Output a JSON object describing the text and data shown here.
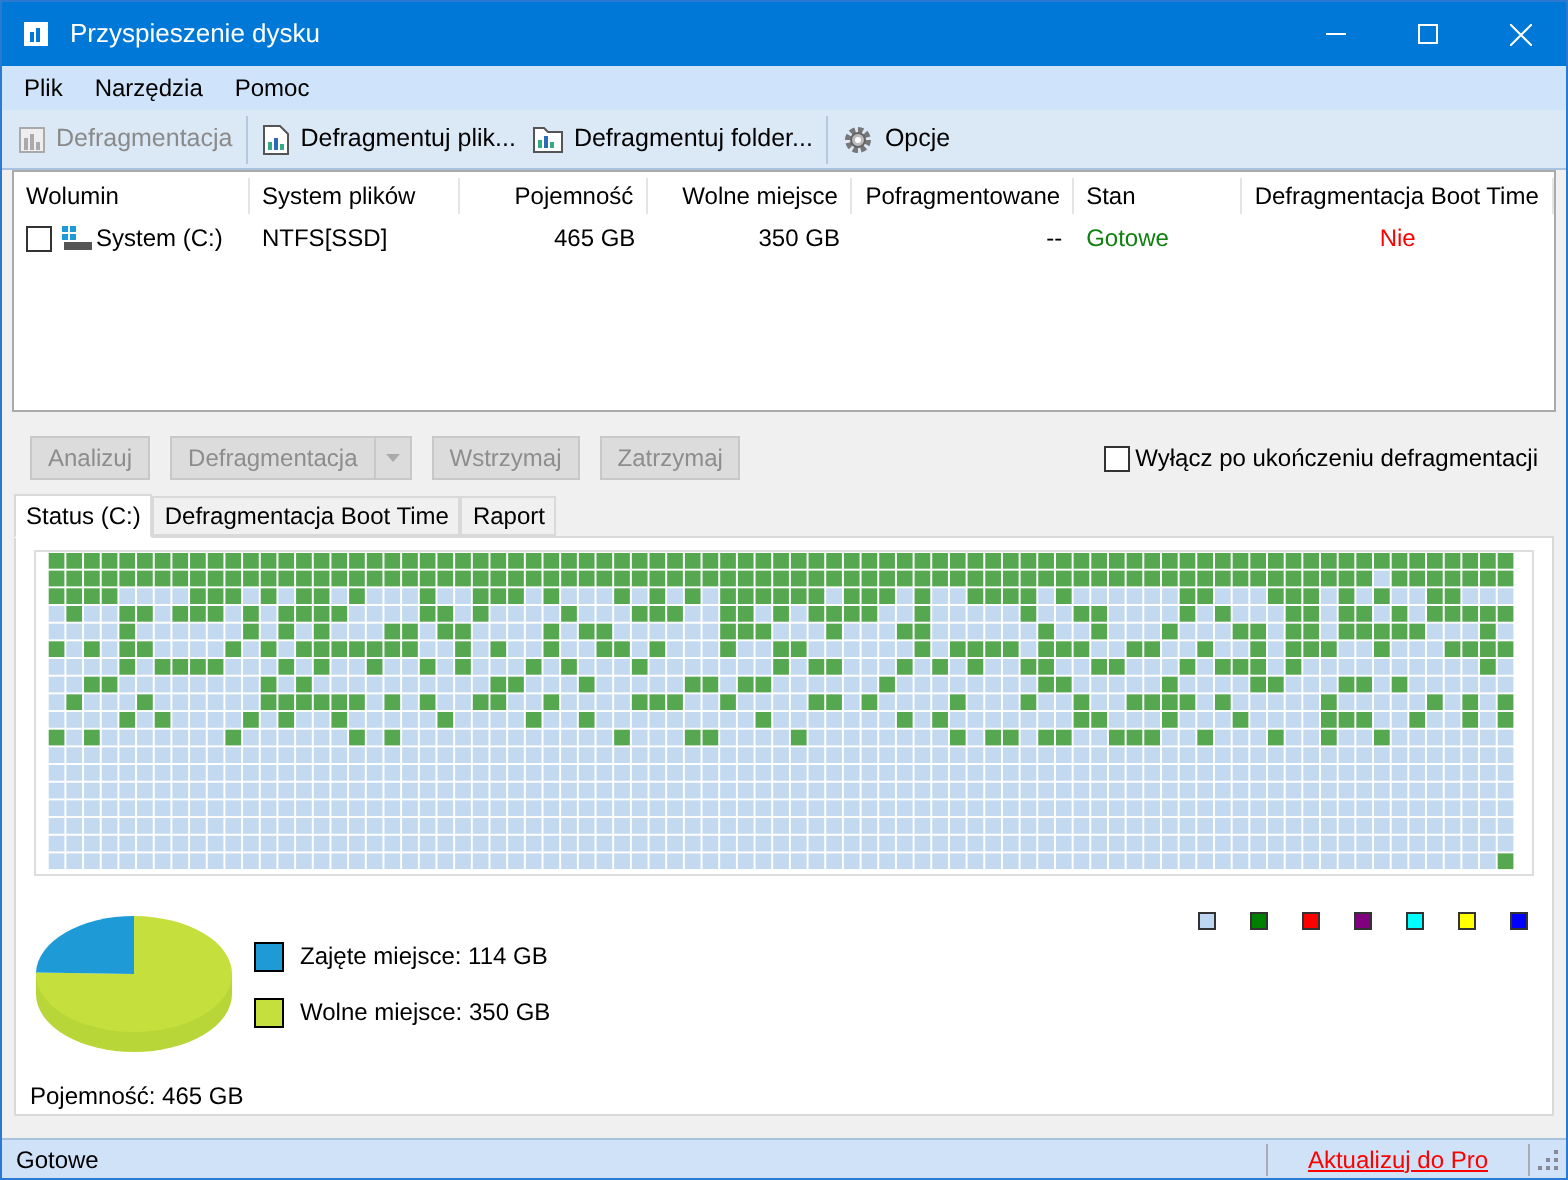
{
  "window": {
    "title": "Przyspieszenie dysku"
  },
  "menu": [
    "Plik",
    "Narzędzia",
    "Pomoc"
  ],
  "toolbar": [
    {
      "label": "Defragmentacja",
      "disabled": true,
      "kind": "chart"
    },
    {
      "label": "Defragmentuj plik...",
      "disabled": false,
      "kind": "file"
    },
    {
      "label": "Defragmentuj folder...",
      "disabled": false,
      "kind": "folder"
    },
    {
      "label": "Opcje",
      "disabled": false,
      "kind": "gear"
    }
  ],
  "table": {
    "columns": [
      "Wolumin",
      "System plików",
      "Pojemność",
      "Wolne miejsce",
      "Pofragmentowane",
      "Stan",
      "Defragmentacja Boot Time"
    ],
    "rows": [
      {
        "checked": false,
        "cells": [
          "System (C:)",
          "NTFS[SSD]",
          "465 GB",
          "350 GB",
          "--",
          "Gotowe",
          "Nie"
        ]
      }
    ]
  },
  "actions": [
    {
      "label": "Analizuj",
      "disabled": true,
      "kind": "plain"
    },
    {
      "label": "Defragmentacja",
      "disabled": true,
      "kind": "split"
    },
    {
      "label": "Wstrzymaj",
      "disabled": true,
      "kind": "plain"
    },
    {
      "label": "Zatrzymaj",
      "disabled": true,
      "kind": "plain"
    }
  ],
  "shutdown_option": {
    "label": "Wyłącz po ukończeniu defragmentacji",
    "checked": false
  },
  "tabs": [
    {
      "label": "Status (C:)",
      "selected": true
    },
    {
      "label": "Defragmentacja Boot Time",
      "selected": false
    },
    {
      "label": "Raport",
      "selected": false
    }
  ],
  "map_legend": [
    {
      "color": "#bdd7f0"
    },
    {
      "color": "#008000"
    },
    {
      "color": "#ff0000"
    },
    {
      "color": "#800080"
    },
    {
      "color": "#00ffff"
    },
    {
      "color": "#ffff00"
    },
    {
      "color": "#0000ff"
    }
  ],
  "disk_usage": {
    "legend": [
      {
        "label": "Zajęte miejsce: 114 GB",
        "color": "#1e9bd7"
      },
      {
        "label": "Wolne miejsce: 350 GB",
        "color": "#c5e03c"
      }
    ],
    "capacity": "Pojemność: 465 GB"
  },
  "status_bar": {
    "text": "Gotowe",
    "link": "Aktualizuj do Pro"
  }
}
